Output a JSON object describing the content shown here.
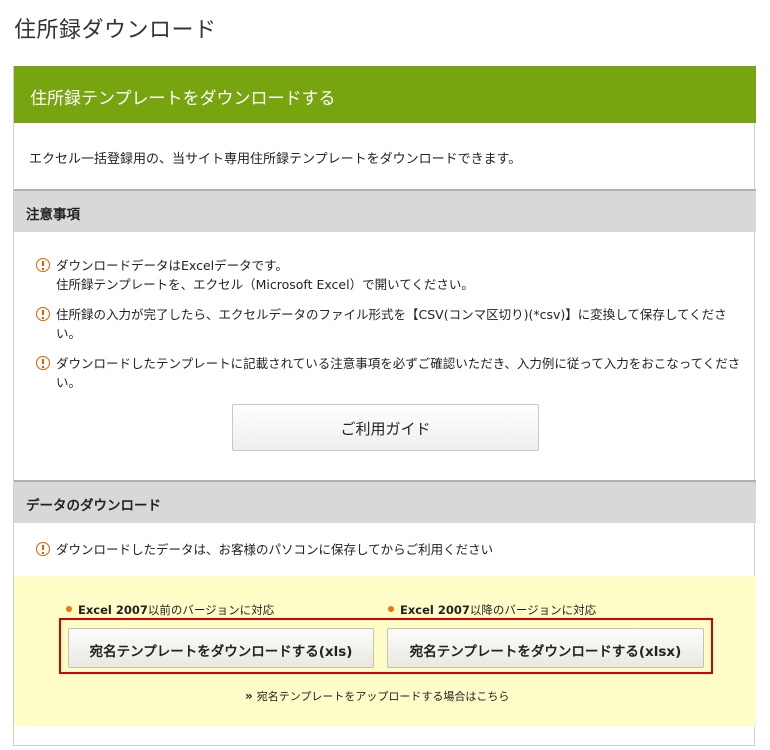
{
  "page": {
    "title": "住所録ダウンロード"
  },
  "template_section": {
    "heading": "住所録テンプレートをダウンロードする",
    "intro": "エクセル一括登録用の、当サイト専用住所録テンプレートをダウンロードできます。"
  },
  "notes_section": {
    "heading": "注意事項",
    "notes": [
      "ダウンロードデータはExcelデータです。\n住所録テンプレートを、エクセル（Microsoft Excel）で開いてください。",
      "住所録の入力が完了したら、エクセルデータのファイル形式を【CSV(コンマ区切り)(*csv)】に変換して保存してください。",
      "ダウンロードしたテンプレートに記載されている注意事項を必ずご確認いただき、入力例に従って入力をおこなってください。"
    ],
    "guide_button": "ご利用ガイド"
  },
  "download_section": {
    "heading": "データのダウンロード",
    "note": "ダウンロードしたデータは、お客様のパソコンに保存してからご利用ください",
    "xls": {
      "version_bold": "Excel 2007",
      "version_text": "以前のバージョンに対応",
      "button": "宛名テンプレートをダウンロードする(xls)"
    },
    "xlsx": {
      "version_bold": "Excel 2007",
      "version_text": "以降のバージョンに対応",
      "button": "宛名テンプレートをダウンロードする(xlsx)"
    },
    "upload_link": "宛名テンプレートをアップロードする場合はこちら"
  },
  "colors": {
    "header_green": "#76a510",
    "warning_orange": "#e06000",
    "highlight_red": "#d60000",
    "download_bg": "#fefdc8"
  },
  "icons": {
    "warning": "exclamation-circle-icon",
    "link_arrow": "double-chevron-right-icon"
  }
}
